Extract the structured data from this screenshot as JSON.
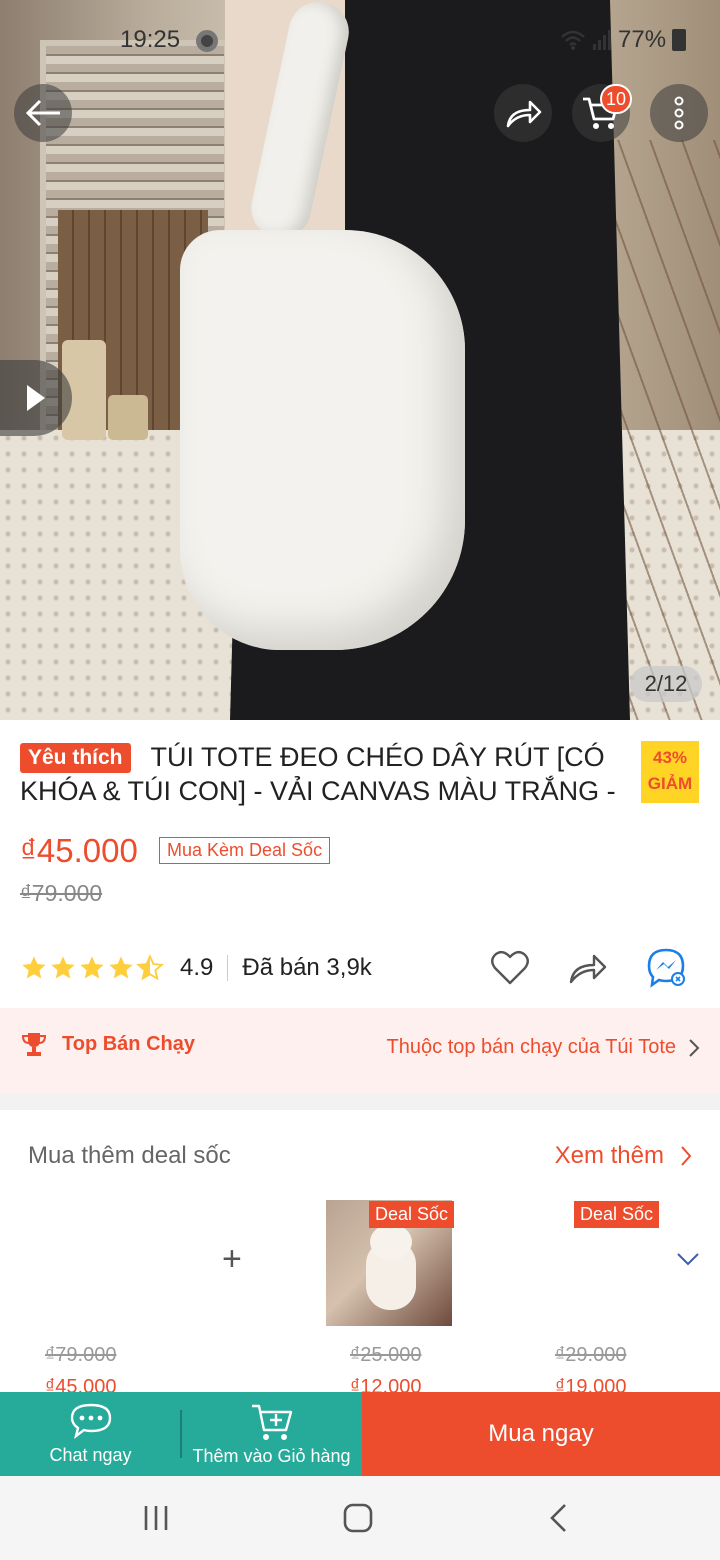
{
  "status_bar": {
    "time": "19:25",
    "battery": "77%"
  },
  "header": {
    "cart_count": "10"
  },
  "gallery": {
    "counter": "2/12"
  },
  "product": {
    "favorite_tag": "Yêu thích",
    "title": "TÚI TOTE ĐEO CHÉO DÂY RÚT [CÓ KHÓA & TÚI CON] - VẢI CANVAS MÀU TRẮNG -",
    "discount_percent": "43%",
    "discount_label": "GIẢM",
    "price": "₫45.000",
    "deal_tag": "Mua Kèm Deal Sốc",
    "old_price": "₫79.000",
    "rating": "4.9",
    "rating_value": 4.9,
    "sold": "Đã bán 3,9k"
  },
  "top_seller": {
    "label": "Top Bán Chạy",
    "detail": "Thuộc top bán chạy của Túi Tote"
  },
  "deal_section": {
    "heading": "Mua thêm deal sốc",
    "see_more": "Xem thêm",
    "items": [
      {
        "badge": "",
        "old_price": "₫79.000",
        "new_price": "₫45.000"
      },
      {
        "badge": "Deal Sốc",
        "old_price": "₫25.000",
        "new_price": "₫12.000"
      },
      {
        "badge": "Deal Sốc",
        "old_price": "₫29.000",
        "new_price": "₫19.000"
      }
    ]
  },
  "bottom_bar": {
    "chat": "Chat ngay",
    "add_to_cart": "Thêm vào Giỏ hàng",
    "buy_now": "Mua ngay"
  },
  "colors": {
    "brand": "#ee4d2d",
    "green": "#26aa99",
    "star": "#ffce3d"
  }
}
